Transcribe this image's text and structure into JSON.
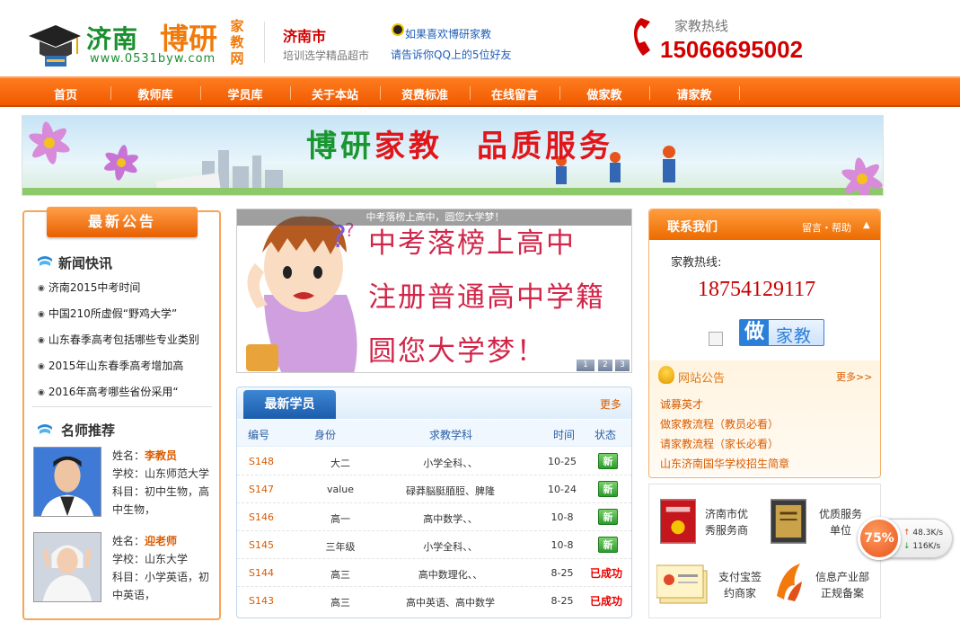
{
  "header": {
    "logo_city": "济南",
    "logo_brand": "博研",
    "logo_side": "家教网",
    "logo_url": "www.0531byw.com",
    "city": "济南市",
    "city_sub": "培训选学精品超市",
    "qq_line1": "如果喜欢博研家教",
    "qq_line2": "请告诉你QQ上的5位好友",
    "hotline_label": "家教热线",
    "hotline": "15066695002"
  },
  "nav": [
    "首页",
    "教师库",
    "学员库",
    "关于本站",
    "资费标准",
    "在线留言",
    "做家教",
    "请家教"
  ],
  "banner": {
    "green": "博研",
    "red": "家教",
    "tail": "品质服务"
  },
  "left": {
    "notice_title": "最新公告",
    "news_head": "新闻快讯",
    "news": [
      "济南2015中考时间",
      "中国210所虚假“野鸡大学”",
      "山东春季高考包括哪些专业类别",
      "2015年山东春季高考增加高",
      "2016年高考哪些省份采用“"
    ],
    "teacher_head": "名师推荐",
    "teachers": [
      {
        "name_label": "姓名：",
        "name": "李教员",
        "school": "学校：山东师范大学",
        "subject": "科目：初中生物，高中生物，"
      },
      {
        "name_label": "姓名：",
        "name": "迎老师",
        "school": "学校：山东大学",
        "subject": "科目：小学英语，初中英语，"
      }
    ]
  },
  "slide": {
    "caption": "中考落榜上高中，圆您大学梦！",
    "lines": [
      "中考落榜上高中",
      "注册普通高中学籍",
      "圆您大学梦！"
    ],
    "pages": [
      "1",
      "2",
      "3"
    ]
  },
  "students": {
    "tab": "最新学员",
    "more": "更多",
    "columns": [
      "编号",
      "身份",
      "求教学科",
      "时间",
      "状态"
    ],
    "rows": [
      {
        "id": "S148",
        "role": "大二",
        "subject": "小学全科、、",
        "date": "10-25",
        "status": "新"
      },
      {
        "id": "S147",
        "role": "value",
        "subject": "碌莽脳脡脜脰、脾隆",
        "date": "10-24",
        "status": "新"
      },
      {
        "id": "S146",
        "role": "高一",
        "subject": "高中数学、、",
        "date": "10-8",
        "status": "新"
      },
      {
        "id": "S145",
        "role": "三年级",
        "subject": "小学全科、、",
        "date": "10-8",
        "status": "新"
      },
      {
        "id": "S144",
        "role": "高三",
        "subject": "高中数理化、、",
        "date": "8-25",
        "status": "已成功"
      },
      {
        "id": "S143",
        "role": "高三",
        "subject": "高中英语、高中数学",
        "date": "8-25",
        "status": "已成功"
      }
    ]
  },
  "contact": {
    "title": "联系我们",
    "links": "留言・帮助",
    "hotline_label": "家教热线:",
    "hotline": "18754129117",
    "btn_a": "做",
    "btn_b": "家教"
  },
  "site_notice": {
    "title": "网站公告",
    "more": "更多>>",
    "items": [
      "诚募英才",
      "做家教流程（教员必看）",
      "请家教流程（家长必看）",
      "山东济南国华学校招生简章"
    ]
  },
  "certs": [
    {
      "text_a": "济南市优",
      "text_b": "秀服务商"
    },
    {
      "text_a": "优质服务",
      "text_b": "单位"
    },
    {
      "text_a": "支付宝签",
      "text_b": "约商家"
    },
    {
      "text_a": "信息产业部",
      "text_b": "正规备案"
    }
  ],
  "speed": {
    "percent": "75%",
    "up": "48.3K/s",
    "down": "116K/s"
  },
  "colors": {
    "brand_orange": "#f05a00",
    "brand_green": "#1a8f2f",
    "accent_red": "#d10000",
    "link_blue": "#1f5fb8"
  }
}
